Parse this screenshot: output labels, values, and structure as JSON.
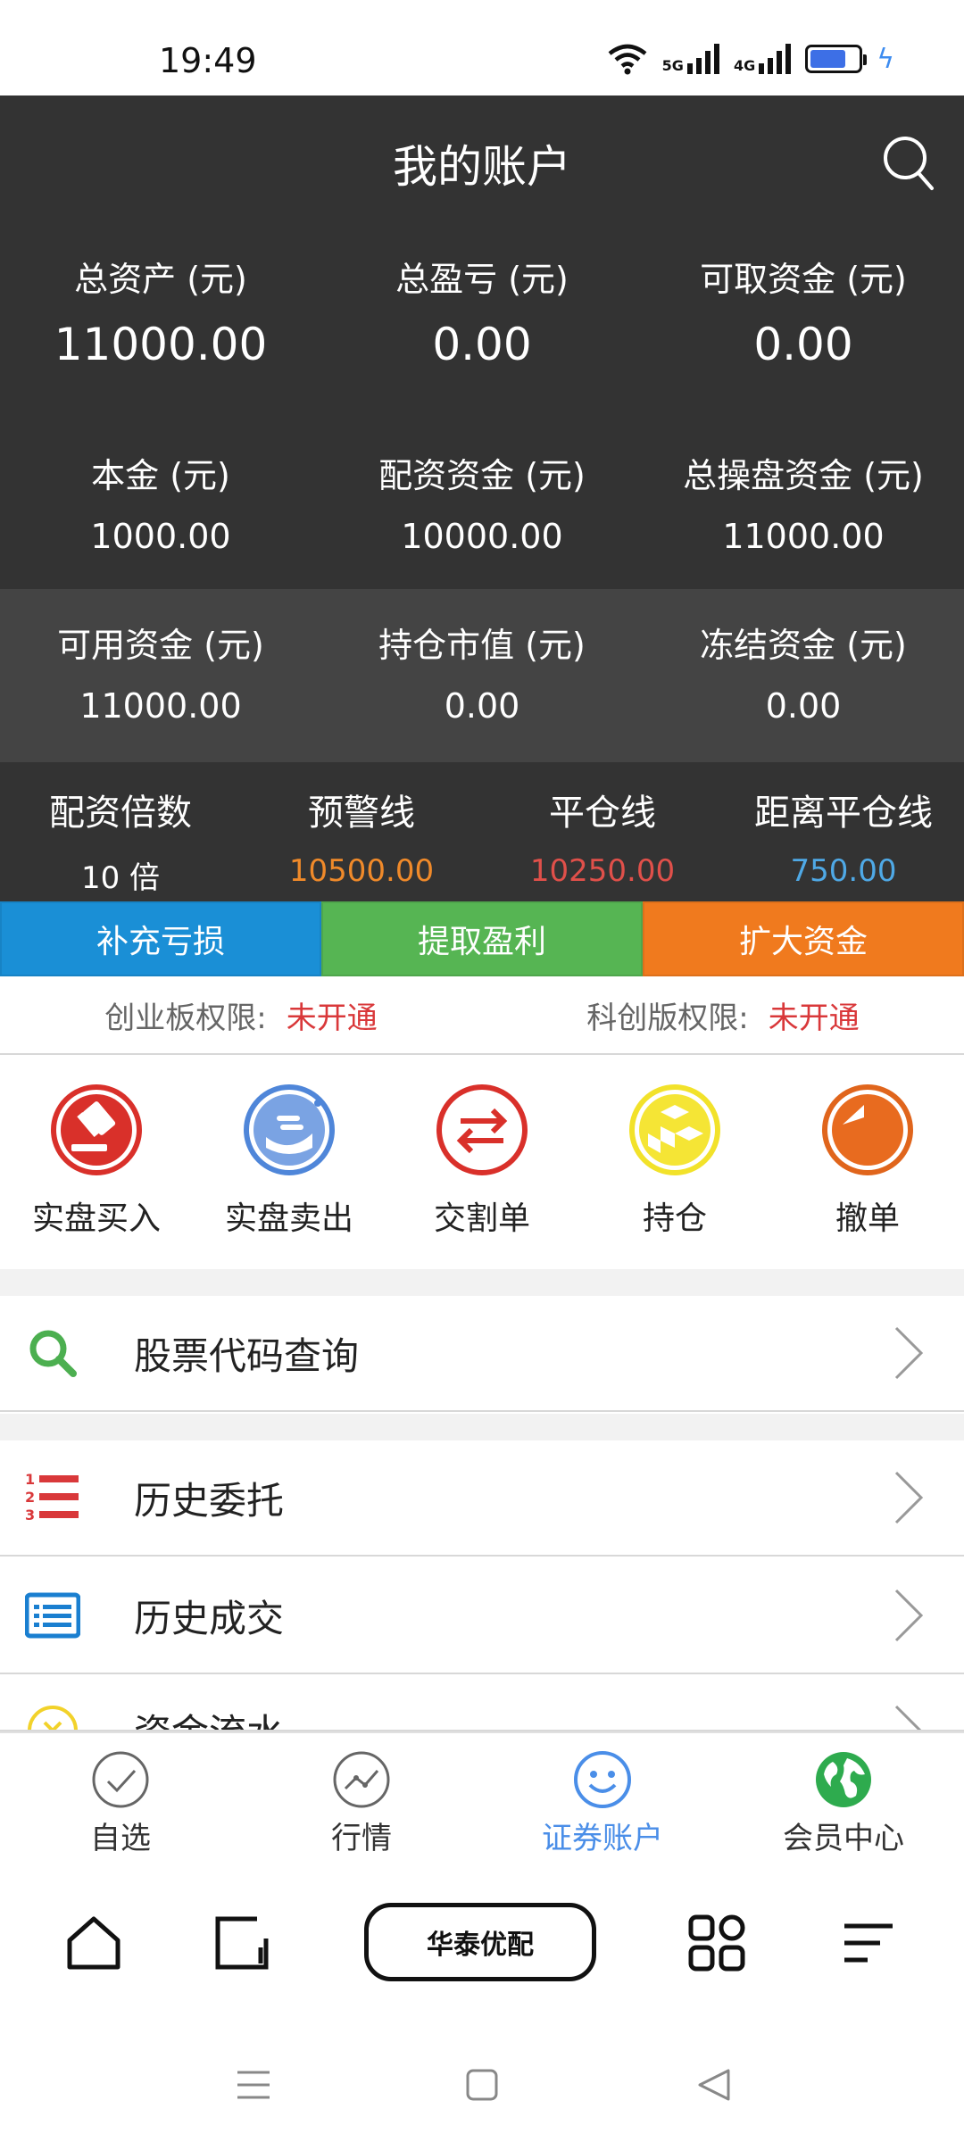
{
  "status_bar": {
    "time": "19:49",
    "net1": "5G",
    "net2": "4G",
    "battery_level": 0.75
  },
  "header": {
    "title": "我的账户",
    "summary": [
      {
        "label": "总资产 (元)",
        "value": "11000.00"
      },
      {
        "label": "总盈亏 (元)",
        "value": "0.00"
      },
      {
        "label": "可取资金 (元)",
        "value": "0.00"
      }
    ]
  },
  "funds_row1": [
    {
      "label": "本金 (元)",
      "value": "1000.00"
    },
    {
      "label": "配资资金 (元)",
      "value": "10000.00"
    },
    {
      "label": "总操盘资金 (元)",
      "value": "11000.00"
    }
  ],
  "funds_row2": [
    {
      "label": "可用资金 (元)",
      "value": "11000.00"
    },
    {
      "label": "持仓市值 (元)",
      "value": "0.00"
    },
    {
      "label": "冻结资金 (元)",
      "value": "0.00"
    }
  ],
  "risk": [
    {
      "label": "配资倍数",
      "value": "10 倍",
      "color": "#ffffff"
    },
    {
      "label": "预警线",
      "value": "10500.00",
      "color": "#f08a2a"
    },
    {
      "label": "平仓线",
      "value": "10250.00",
      "color": "#e0504a"
    },
    {
      "label": "距离平仓线",
      "value": "750.00",
      "color": "#4fa9e6"
    }
  ],
  "actions": [
    {
      "label": "补充亏损",
      "color": "#1a8fd6"
    },
    {
      "label": "提取盈利",
      "color": "#56b553"
    },
    {
      "label": "扩大资金",
      "color": "#f07a1e"
    }
  ],
  "permissions": [
    {
      "label": "创业板权限:",
      "value": "未开通"
    },
    {
      "label": "科创版权限:",
      "value": "未开通"
    }
  ],
  "quick_actions": [
    {
      "label": "实盘买入",
      "icon": "gavel-icon"
    },
    {
      "label": "实盘卖出",
      "icon": "hand-coin-icon"
    },
    {
      "label": "交割单",
      "icon": "swap-arrows-icon"
    },
    {
      "label": "持仓",
      "icon": "boxes-icon"
    },
    {
      "label": "撤单",
      "icon": "undo-icon"
    }
  ],
  "menu": [
    {
      "label": "股票代码查询",
      "icon": "search-icon"
    },
    {
      "label": "历史委托",
      "icon": "numbered-list-icon"
    },
    {
      "label": "历史成交",
      "icon": "list-card-icon"
    },
    {
      "label": "资金流水",
      "icon": "clock-icon"
    }
  ],
  "tabs": [
    {
      "label": "自选",
      "icon": "check-circle-icon",
      "active": false
    },
    {
      "label": "行情",
      "icon": "chart-circle-icon",
      "active": false
    },
    {
      "label": "证券账户",
      "icon": "smiley-icon",
      "active": true
    },
    {
      "label": "会员中心",
      "icon": "globe-icon",
      "active": false
    }
  ],
  "browser": {
    "brand": "华泰优配"
  },
  "colors": {
    "header_bg": "#333333",
    "row_alt_bg": "#444444",
    "accent_red": "#d9383a",
    "active_tab": "#4a8ee8"
  }
}
